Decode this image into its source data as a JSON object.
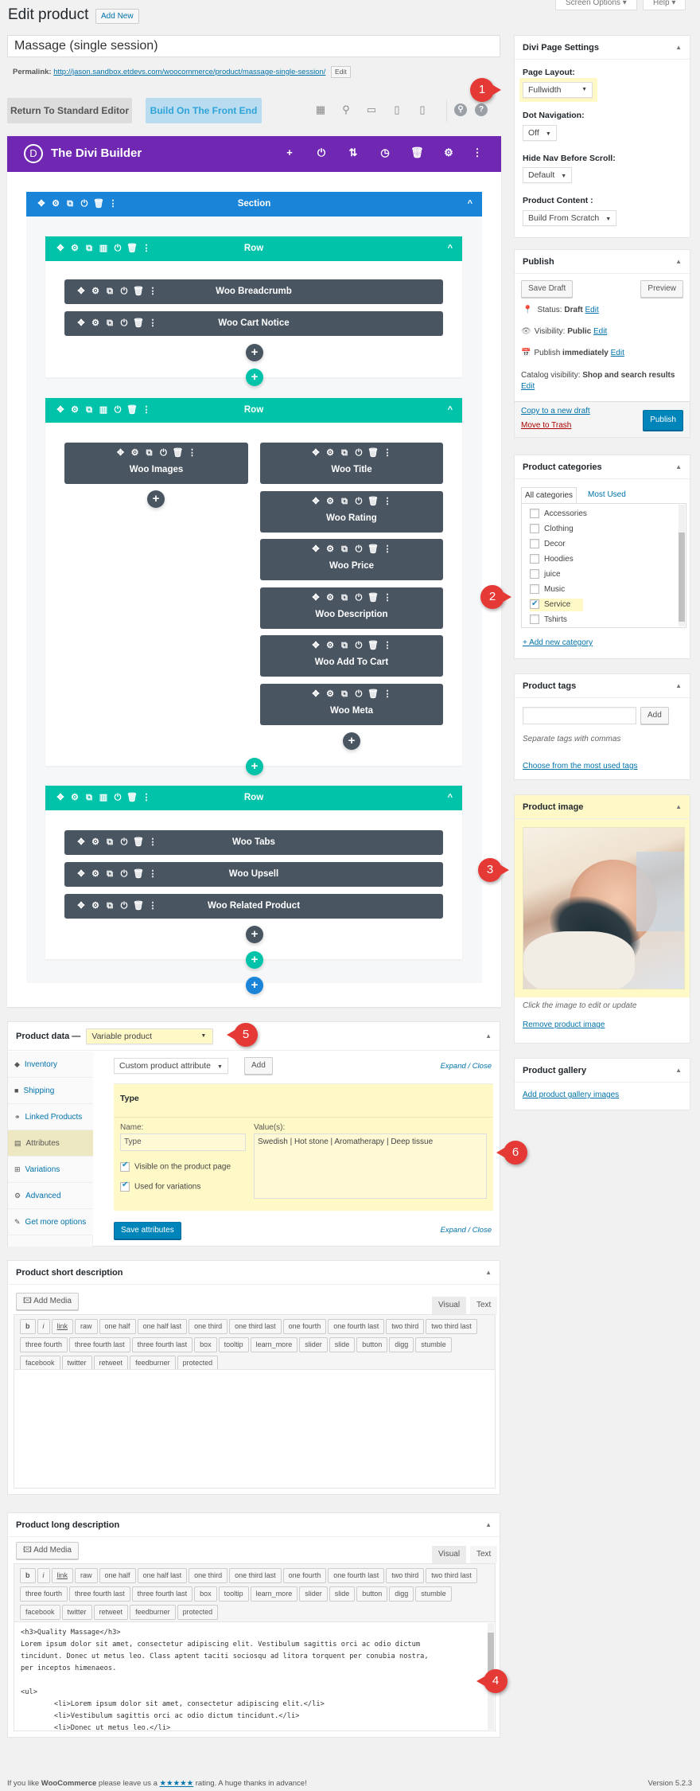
{
  "header": {
    "page_title": "Edit product",
    "add_new": "Add New",
    "screen_options": "Screen Options ▾",
    "help": "Help ▾",
    "product_title": "Massage (single session)",
    "permalink_label": "Permalink:",
    "permalink_url": "http://jason.sandbox.etdevs.com/woocommerce/product/massage-single-session/",
    "permalink_edit": "Edit"
  },
  "builder_toolbar": {
    "return_button": "Return To Standard Editor",
    "build_front_button": "Build On The Front End",
    "icons": {
      "layout": "▦",
      "zoom": "⚲",
      "desktop": "▭",
      "tablet": "▯",
      "phone": "▯",
      "search": "⚲",
      "help": "?"
    }
  },
  "divi": {
    "logo": "D",
    "title": "The Divi Builder",
    "header_icons": {
      "add": "+",
      "power": "⏻",
      "sort": "⇅",
      "history": "◷",
      "trash": "🗑",
      "settings": "⚙",
      "more": "⋮"
    },
    "section_label": "Section",
    "row_label": "Row",
    "bar_icons": {
      "move": "✥",
      "settings": "⚙",
      "duplicate": "⧉",
      "columns": "▥",
      "power": "⏻",
      "trash": "🗑",
      "more": "⋮",
      "collapse": "^",
      "plus": "+"
    },
    "row1_modules": [
      "Woo Breadcrumb",
      "Woo Cart Notice"
    ],
    "row2_left": [
      "Woo Images"
    ],
    "row2_right": [
      "Woo Title",
      "Woo Rating",
      "Woo Price",
      "Woo Description",
      "Woo Add To Cart",
      "Woo Meta"
    ],
    "row3_modules": [
      "Woo Tabs",
      "Woo Upsell",
      "Woo Related Product"
    ]
  },
  "divi_settings": {
    "title": "Divi Page Settings",
    "page_layout_label": "Page Layout:",
    "page_layout_value": "Fullwidth",
    "dot_nav_label": "Dot Navigation:",
    "dot_nav_value": "Off",
    "hide_nav_label": "Hide Nav Before Scroll:",
    "hide_nav_value": "Default",
    "product_content_label": "Product Content :",
    "product_content_value": "Build From Scratch"
  },
  "publish": {
    "title": "Publish",
    "save_draft": "Save Draft",
    "preview": "Preview",
    "status_label": "Status:",
    "status_value": "Draft",
    "visibility_label": "Visibility:",
    "visibility_value": "Public",
    "publish_label": "Publish",
    "publish_value": "immediately",
    "edit": "Edit",
    "catalog_label": "Catalog visibility:",
    "catalog_value": "Shop and search results",
    "copy_draft": "Copy to a new draft",
    "trash": "Move to Trash",
    "publish_button": "Publish"
  },
  "categories": {
    "title": "Product categories",
    "tab_all": "All categories",
    "tab_most_used": "Most Used",
    "items": [
      {
        "label": "Accessories",
        "checked": false
      },
      {
        "label": "Clothing",
        "checked": false
      },
      {
        "label": "Decor",
        "checked": false
      },
      {
        "label": "Hoodies",
        "checked": false
      },
      {
        "label": "juice",
        "checked": false
      },
      {
        "label": "Music",
        "checked": false
      },
      {
        "label": "Service",
        "checked": true
      },
      {
        "label": "Tshirts",
        "checked": false
      }
    ],
    "add_new": "+ Add new category"
  },
  "tags": {
    "title": "Product tags",
    "input_value": "",
    "add_button": "Add",
    "hint": "Separate tags with commas",
    "choose_link": "Choose from the most used tags"
  },
  "product_image": {
    "title": "Product image",
    "caption": "Click the image to edit or update",
    "remove_link": "Remove product image"
  },
  "gallery": {
    "title": "Product gallery",
    "add_link": "Add product gallery images"
  },
  "product_data": {
    "title": "Product data —",
    "type_value": "Variable product",
    "tabs": [
      {
        "icon": "◆",
        "label": "Inventory"
      },
      {
        "icon": "■",
        "label": "Shipping"
      },
      {
        "icon": "⚭",
        "label": "Linked Products"
      },
      {
        "icon": "▤",
        "label": "Attributes"
      },
      {
        "icon": "⊞",
        "label": "Variations"
      },
      {
        "icon": "⚙",
        "label": "Advanced"
      },
      {
        "icon": "✎",
        "label": "Get more options"
      }
    ],
    "attr_select": "Custom product attribute",
    "add_button": "Add",
    "expand_close": "Expand / Close",
    "attribute_heading": "Type",
    "name_label": "Name:",
    "name_value": "Type",
    "values_label": "Value(s):",
    "values_value": "Swedish | Hot stone | Aromatherapy | Deep tissue",
    "visible_label": "Visible on the product page",
    "variations_label": "Used for variations",
    "save_button": "Save attributes"
  },
  "editor_buttons": {
    "add_media": "Add Media",
    "visual": "Visual",
    "text": "Text",
    "quicktags": [
      "b",
      "i",
      "link",
      "raw",
      "one half",
      "one half last",
      "one third",
      "one third last",
      "one fourth",
      "one fourth last",
      "two third",
      "two third last",
      "three fourth",
      "three fourth last",
      "three fourth last",
      "box",
      "tooltip",
      "learn_more",
      "slider",
      "slide",
      "button",
      "digg",
      "stumble",
      "facebook",
      "twitter",
      "retweet",
      "feedburner",
      "protected"
    ]
  },
  "short_description": {
    "title": "Product short description",
    "content": ""
  },
  "long_description": {
    "title": "Product long description",
    "content": "<h3>Quality Massage</h3>\nLorem ipsum dolor sit amet, consectetur adipiscing elit. Vestibulum sagittis orci ac odio dictum\ntincidunt. Donec ut metus leo. Class aptent taciti sociosqu ad litora torquent per conubia nostra,\nper inceptos himenaeos.\n\n<ul>\n        <li>Lorem ipsum dolor sit amet, consectetur adipiscing elit.</li>\n        <li>Vestibulum sagittis orci ac odio dictum tincidunt.</li>\n        <li>Donec ut metus leo.</li>"
  },
  "footer": {
    "left_prefix": "If you like ",
    "brand": "WooCommerce",
    "left_middle": " please leave us a ",
    "stars": "★★★★★",
    "left_suffix": " rating. A huge thanks in advance!",
    "version": "Version 5.2.3"
  },
  "markers": [
    "1",
    "2",
    "3",
    "4",
    "5",
    "6"
  ]
}
